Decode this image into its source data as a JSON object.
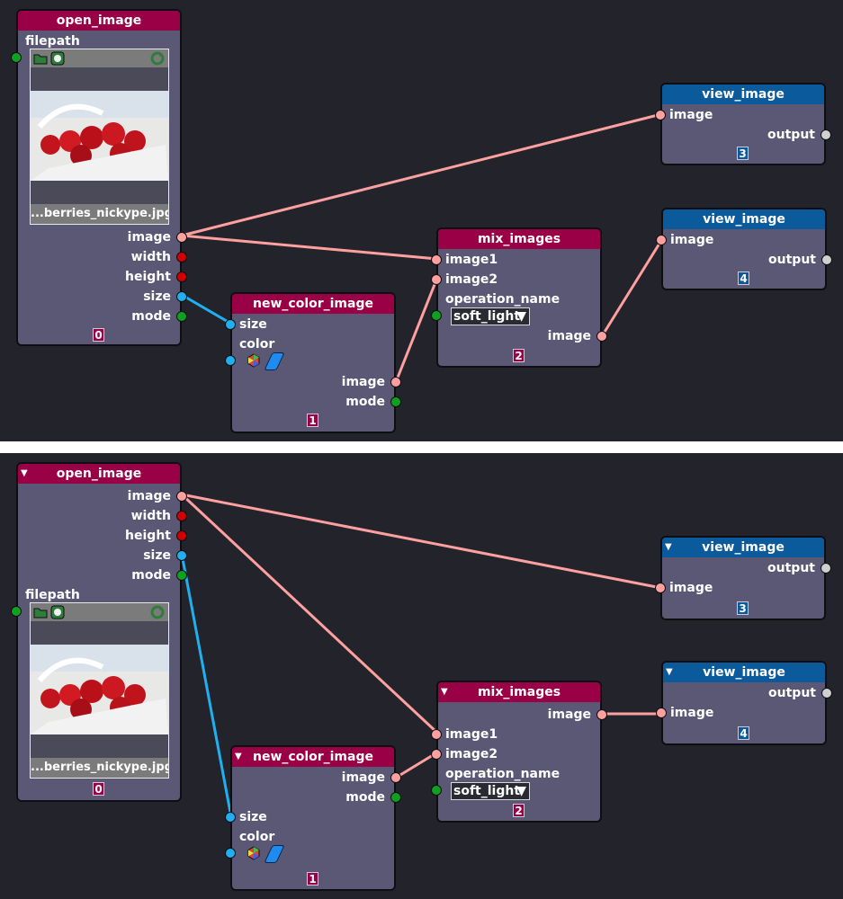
{
  "index_badges": [
    "0",
    "1",
    "2",
    "3",
    "4"
  ],
  "colors": {
    "canvas": "#23232b",
    "node_body": "#5b5876",
    "header_red": "#990045",
    "header_blue": "#0b5a9c",
    "wire_image": "#ffa0a0",
    "wire_size": "#20b0f0",
    "socket_green": "#10a020",
    "socket_red": "#d00000"
  },
  "panels": {
    "top": {
      "open_image": {
        "title": "open_image",
        "filepath_label": "filepath",
        "filename": "...berries_nickype.jpg",
        "outputs": [
          "image",
          "width",
          "height",
          "size",
          "mode"
        ],
        "index": "0",
        "icons": [
          "open-folder-icon",
          "image-gallery-icon",
          "reload-icon"
        ]
      },
      "new_color_image": {
        "title": "new_color_image",
        "inputs": [
          "size",
          "color"
        ],
        "outputs": [
          "image",
          "mode"
        ],
        "index": "1",
        "icons": [
          "color-wheel-icon",
          "color-swatch-icon"
        ]
      },
      "mix_images": {
        "title": "mix_images",
        "inputs": [
          "image1",
          "image2"
        ],
        "operation_label": "operation_name",
        "operation_value": "soft_light",
        "outputs": [
          "image"
        ],
        "index": "2"
      },
      "view_image_a": {
        "title": "view_image",
        "inputs": [
          "image"
        ],
        "outputs": [
          "output"
        ],
        "index": "3"
      },
      "view_image_b": {
        "title": "view_image",
        "inputs": [
          "image"
        ],
        "outputs": [
          "output"
        ],
        "index": "4"
      }
    },
    "bottom": {
      "open_image": {
        "title": "open_image",
        "collapse": "▼",
        "filepath_label": "filepath",
        "filename": "...berries_nickype.jpg",
        "outputs": [
          "image",
          "width",
          "height",
          "size",
          "mode"
        ],
        "index": "0",
        "icons": [
          "open-folder-icon",
          "image-gallery-icon",
          "reload-icon"
        ]
      },
      "new_color_image": {
        "title": "new_color_image",
        "collapse": "▼",
        "inputs": [
          "size",
          "color"
        ],
        "outputs": [
          "image",
          "mode"
        ],
        "index": "1",
        "icons": [
          "color-wheel-icon",
          "color-swatch-icon"
        ]
      },
      "mix_images": {
        "title": "mix_images",
        "collapse": "▼",
        "inputs": [
          "image1",
          "image2"
        ],
        "operation_label": "operation_name",
        "operation_value": "soft_light",
        "outputs": [
          "image"
        ],
        "index": "2"
      },
      "view_image_a": {
        "title": "view_image",
        "collapse": "▼",
        "inputs": [
          "image"
        ],
        "outputs": [
          "output"
        ],
        "index": "3"
      },
      "view_image_b": {
        "title": "view_image",
        "collapse": "▼",
        "inputs": [
          "image"
        ],
        "outputs": [
          "output"
        ],
        "index": "4"
      }
    }
  },
  "dropdown_arrow": "▼",
  "connections": [
    {
      "from": "open_image.image",
      "to": "view_image_a.image"
    },
    {
      "from": "open_image.image",
      "to": "mix_images.image1"
    },
    {
      "from": "open_image.size",
      "to": "new_color_image.size"
    },
    {
      "from": "new_color_image.image",
      "to": "mix_images.image2"
    },
    {
      "from": "mix_images.image",
      "to": "view_image_b.image"
    }
  ]
}
